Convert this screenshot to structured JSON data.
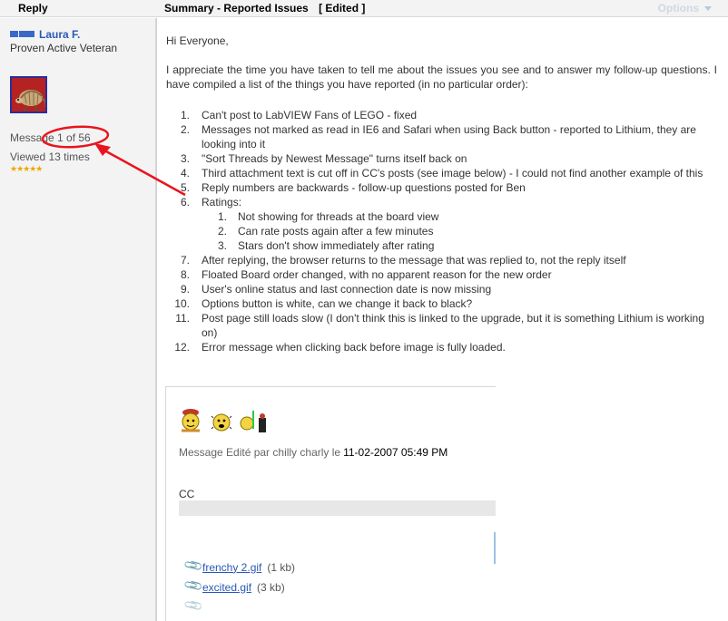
{
  "header": {
    "reply_label": "Reply",
    "summary_label": "Summary - Reported Issues",
    "edited_label": "[ Edited ]",
    "options_label": "Options"
  },
  "author": {
    "name": "Laura F.",
    "rank": "Proven Active Veteran",
    "message_count": "Message 1 of 56",
    "viewed": "Viewed 13 times",
    "stars": "★★★★★"
  },
  "post": {
    "greeting": "Hi Everyone,",
    "intro": "I appreciate the time you have taken to tell me about the issues you see and to answer my follow-up questions.  I have compiled a list of the things you have reported (in no particular order):",
    "issues": [
      {
        "num": "1.",
        "text": "Can't post to LabVIEW Fans of LEGO - fixed"
      },
      {
        "num": "2.",
        "text": "Messages not marked as read in IE6 and Safari when using Back button - reported to Lithium, they are looking into it"
      },
      {
        "num": "3.",
        "text": "\"Sort Threads by Newest Message\" turns itself back on"
      },
      {
        "num": "4.",
        "text": "Third attachment text is cut off in CC's posts (see image below) - I could not find another example of this"
      },
      {
        "num": "5.",
        "text": "Reply numbers are backwards - follow-up questions posted for Ben"
      },
      {
        "num": "6.",
        "text": "Ratings:"
      },
      {
        "num": "7.",
        "text": "After replying, the browser returns to the message that was replied to, not the reply itself"
      },
      {
        "num": "8.",
        "text": "Floated Board order changed, with no apparent reason for the new order"
      },
      {
        "num": "9.",
        "text": "User's online status and last connection date is now missing"
      },
      {
        "num": "10.",
        "text": "Options button is white, can we change it back to black?"
      },
      {
        "num": "11.",
        "text": "Post page still loads slow (I don't think this is linked to the upgrade, but it is something Lithium is working on)"
      },
      {
        "num": "12.",
        "text": "Error message when clicking back before image is fully loaded."
      }
    ],
    "ratings_sub": [
      {
        "num": "1.",
        "text": "Not showing for threads at the board view"
      },
      {
        "num": "2.",
        "text": "Can rate posts again after a few minutes"
      },
      {
        "num": "3.",
        "text": "Stars don't show immediately after rating"
      }
    ]
  },
  "embedded": {
    "edit_note": "Message Edité par chilly charly le",
    "edit_date": "11-02-2007 05:49 PM",
    "signature": "CC",
    "attachments": [
      {
        "name": "frenchy 2.gif",
        "size": "(1 kb)"
      },
      {
        "name": "excited.gif",
        "size": "(3 kb)"
      }
    ]
  },
  "colors": {
    "link": "#2a58b8",
    "annotation": "#e8141e",
    "stars": "#f0a800"
  }
}
